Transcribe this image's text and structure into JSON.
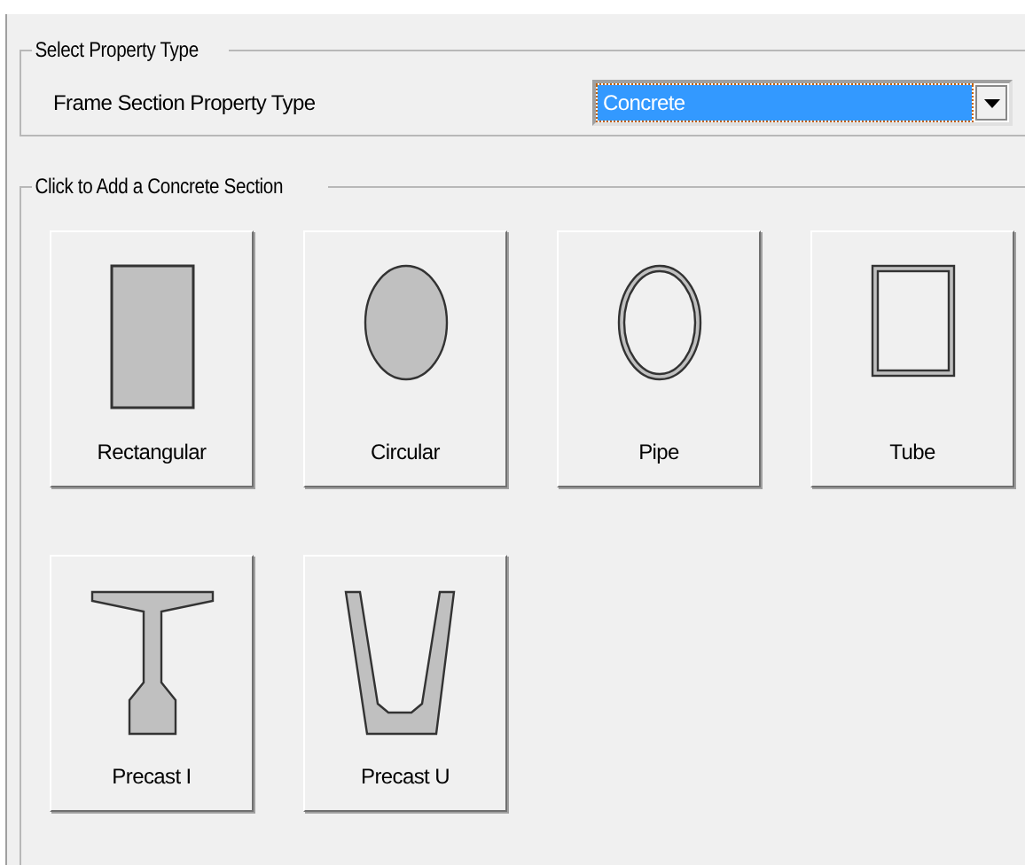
{
  "property_type": {
    "group_title": "Select Property Type",
    "label": "Frame Section Property Type",
    "value": "Concrete"
  },
  "sections": {
    "group_title": "Click to Add a Concrete Section",
    "buttons": [
      {
        "label": "Rectangular",
        "kind": "rectangular"
      },
      {
        "label": "Circular",
        "kind": "circular"
      },
      {
        "label": "Pipe",
        "kind": "pipe"
      },
      {
        "label": "Tube",
        "kind": "tube"
      },
      {
        "label": "Precast I",
        "kind": "precast_i"
      },
      {
        "label": "Precast U",
        "kind": "precast_u"
      }
    ]
  }
}
